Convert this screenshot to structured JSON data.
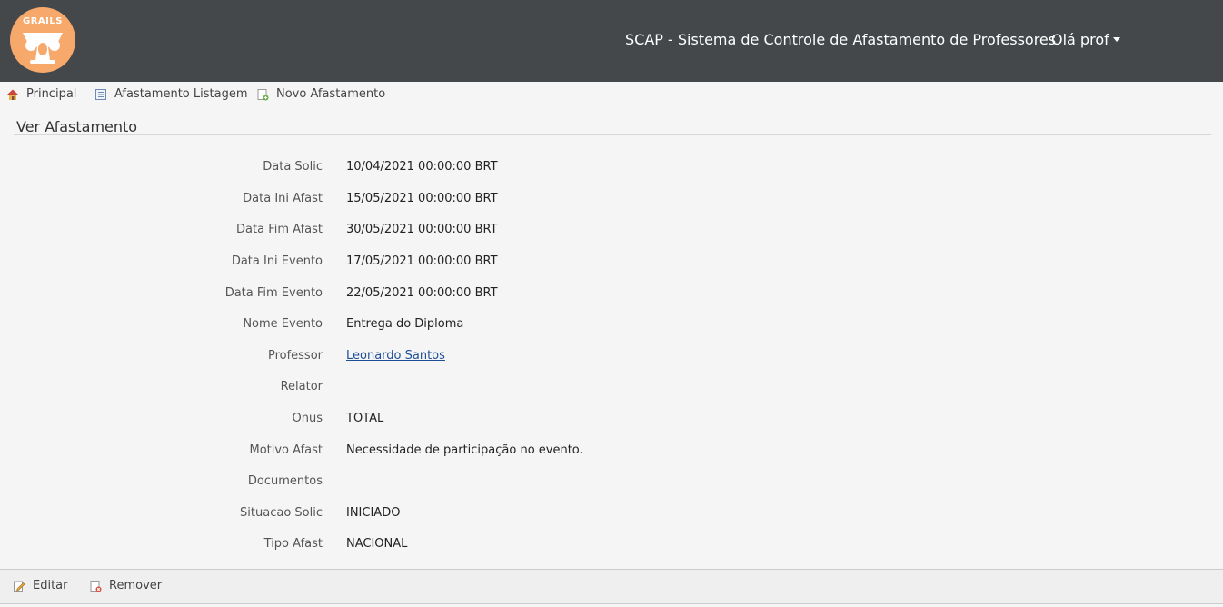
{
  "header": {
    "logo_text": "GRAILS",
    "app_title": "SCAP - Sistema de Controle de Afastamento de Professores",
    "user_menu": "Olá prof"
  },
  "nav": {
    "items": [
      {
        "label": "Principal",
        "icon": "home-icon"
      },
      {
        "label": "Afastamento Listagem",
        "icon": "list-icon"
      },
      {
        "label": "Novo Afastamento",
        "icon": "new-document-icon"
      }
    ]
  },
  "page": {
    "title": "Ver Afastamento"
  },
  "properties": [
    {
      "label": "Data Solic",
      "value": "10/04/2021 00:00:00 BRT"
    },
    {
      "label": "Data Ini Afast",
      "value": "15/05/2021 00:00:00 BRT"
    },
    {
      "label": "Data Fim Afast",
      "value": "30/05/2021 00:00:00 BRT"
    },
    {
      "label": "Data Ini Evento",
      "value": "17/05/2021 00:00:00 BRT"
    },
    {
      "label": "Data Fim Evento",
      "value": "22/05/2021 00:00:00 BRT"
    },
    {
      "label": "Nome Evento",
      "value": "Entrega do Diploma"
    },
    {
      "label": "Professor",
      "value": "Leonardo Santos"
    },
    {
      "label": "Relator",
      "value": ""
    },
    {
      "label": "Onus",
      "value": "TOTAL"
    },
    {
      "label": "Motivo Afast",
      "value": "Necessidade de participação no evento."
    },
    {
      "label": "Documentos",
      "value": ""
    },
    {
      "label": "Situacao Solic",
      "value": "INICIADO"
    },
    {
      "label": "Tipo Afast",
      "value": "NACIONAL"
    }
  ],
  "actions": {
    "edit_label": "Editar",
    "remove_label": "Remover"
  },
  "colors": {
    "header_bg": "#45484b",
    "logo": "#f7a86b",
    "link": "#1f4e99"
  }
}
